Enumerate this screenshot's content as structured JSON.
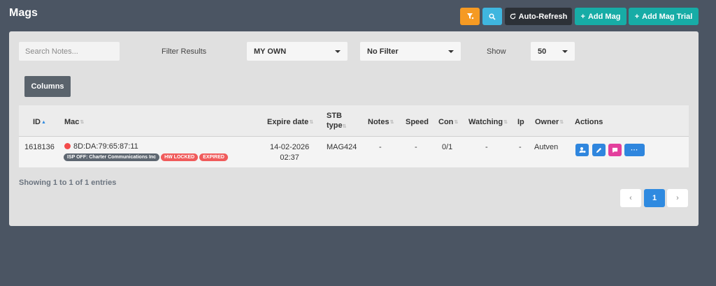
{
  "header": {
    "title": "Mags",
    "auto_refresh_label": "Auto-Refresh",
    "add_mag_label": "Add Mag",
    "add_mag_trial_label": "Add Mag Trial"
  },
  "colors": {
    "background": "#4b5563",
    "filter_button": "#f59a23",
    "search_button": "#3fb6df",
    "auto_refresh_button": "#2c3137",
    "add_button": "#17aca6",
    "action_blue": "#2f86de",
    "action_pink": "#e33f9d",
    "status_red": "#f34b4b"
  },
  "icons": {
    "filter": "filter-clear-icon",
    "search": "search-icon",
    "refresh": "refresh-icon",
    "add": "plus-icon"
  },
  "filters": {
    "search_placeholder": "Search Notes...",
    "filter_results_label": "Filter Results",
    "owner_filter_value": "MY OWN",
    "status_filter_value": "No Filter",
    "show_label": "Show",
    "show_value": "50",
    "columns_label": "Columns"
  },
  "table": {
    "headers": {
      "id": "ID",
      "mac": "Mac",
      "expire_date": "Expire date",
      "stb_type_line1": "STB",
      "stb_type_line2": "type",
      "notes": "Notes",
      "speed": "Speed",
      "con": "Con",
      "watching": "Watching",
      "ip": "Ip",
      "owner": "Owner",
      "actions": "Actions"
    },
    "rows": [
      {
        "id": "1618136",
        "mac": "8D:DA:79:65:87:11",
        "badges": {
          "isp": "ISP OFF: Charter Communications Inc",
          "hw_locked": "HW LOCKED",
          "expired": "EXPIRED"
        },
        "expire_date": "14-02-2026",
        "expire_time": "02:37",
        "stb_type": "MAG424",
        "notes": "-",
        "speed": "-",
        "con": "0/1",
        "watching": "-",
        "ip": "-",
        "owner": "Autven",
        "more_label": "···"
      }
    ]
  },
  "footer": {
    "showing_text": "Showing 1 to 1 of 1 entries",
    "prev_label": "‹",
    "current_page": "1",
    "next_label": "›"
  }
}
